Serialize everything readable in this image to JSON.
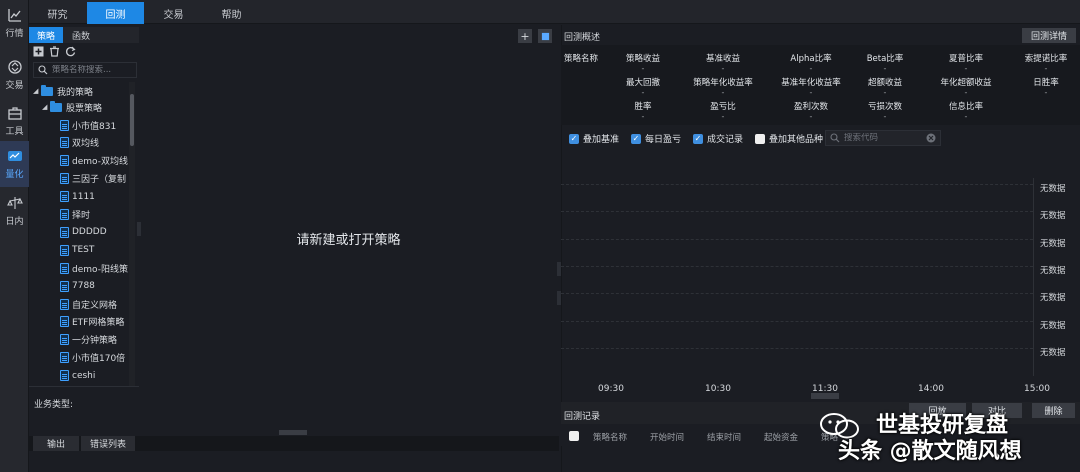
{
  "rail": [
    {
      "label": "行情",
      "icon": "chart-trend-icon"
    },
    {
      "label": "交易",
      "icon": "exchange-icon"
    },
    {
      "label": "工具",
      "icon": "toolbox-icon"
    },
    {
      "label": "量化",
      "icon": "quant-icon",
      "active": true
    },
    {
      "label": "日内",
      "icon": "intraday-icon"
    }
  ],
  "top_tabs": [
    {
      "label": "研究"
    },
    {
      "label": "回测",
      "active": true
    },
    {
      "label": "交易"
    },
    {
      "label": "帮助"
    }
  ],
  "left_panel": {
    "tabs": [
      {
        "label": "策略",
        "active": true
      },
      {
        "label": "函数"
      }
    ],
    "search_placeholder": "策略名称搜索...",
    "tree_root": "我的策略",
    "tree_folder": "股票策略",
    "strategies": [
      "小市值831",
      "双均线",
      "demo-双均线",
      "三因子（复制",
      "1111",
      "择时",
      "DDDDD",
      "TEST",
      "demo-阳线策",
      "7788",
      "自定义网格",
      "ETF网格策略",
      "一分钟策略",
      "小市值170倍",
      "ceshi"
    ],
    "biz_type_label": "业务类型:"
  },
  "editor": {
    "message": "请新建或打开策略",
    "add_label": "+"
  },
  "bottom_tabs": [
    "输出",
    "错误列表"
  ],
  "right_panel": {
    "title": "回测概述",
    "detail_button": "回测详情",
    "stats": [
      {
        "label": "策略名称",
        "value": ""
      },
      {
        "label": "策略收益",
        "value": "-"
      },
      {
        "label": "基准收益",
        "value": "-"
      },
      {
        "label": "Alpha比率",
        "value": "-"
      },
      {
        "label": "Beta比率",
        "value": "-"
      },
      {
        "label": "夏普比率",
        "value": "-"
      },
      {
        "label": "索提诺比率",
        "value": "-"
      },
      {
        "label": "最大回撤",
        "value": "-"
      },
      {
        "label": "策略年化收益率",
        "value": "-"
      },
      {
        "label": "基准年化收益率",
        "value": "-"
      },
      {
        "label": "超额收益",
        "value": "-"
      },
      {
        "label": "年化超额收益",
        "value": "-"
      },
      {
        "label": "日胜率",
        "value": "-"
      },
      {
        "label": "胜率",
        "value": "-"
      },
      {
        "label": "盈亏比",
        "value": "-"
      },
      {
        "label": "盈利次数",
        "value": "-"
      },
      {
        "label": "亏损次数",
        "value": "-"
      },
      {
        "label": "信息比率",
        "value": "-"
      }
    ],
    "options": [
      {
        "label": "叠加基准",
        "checked": true
      },
      {
        "label": "每日盈亏",
        "checked": true
      },
      {
        "label": "成交记录",
        "checked": true
      },
      {
        "label": "叠加其他品种",
        "checked": false
      }
    ],
    "code_search_placeholder": "搜索代码",
    "no_data_label": "无数据",
    "x_ticks": [
      "09:30",
      "10:30",
      "11:30",
      "14:00",
      "15:00"
    ],
    "records_title": "回测记录",
    "record_buttons": [
      "回放",
      "对比",
      "删除"
    ],
    "record_columns": [
      "策略名称",
      "开始时间",
      "结束时间",
      "起始资金",
      "策略"
    ]
  },
  "watermark": {
    "line1": "世基投研复盘",
    "line2": "头条 @散文随风想"
  }
}
